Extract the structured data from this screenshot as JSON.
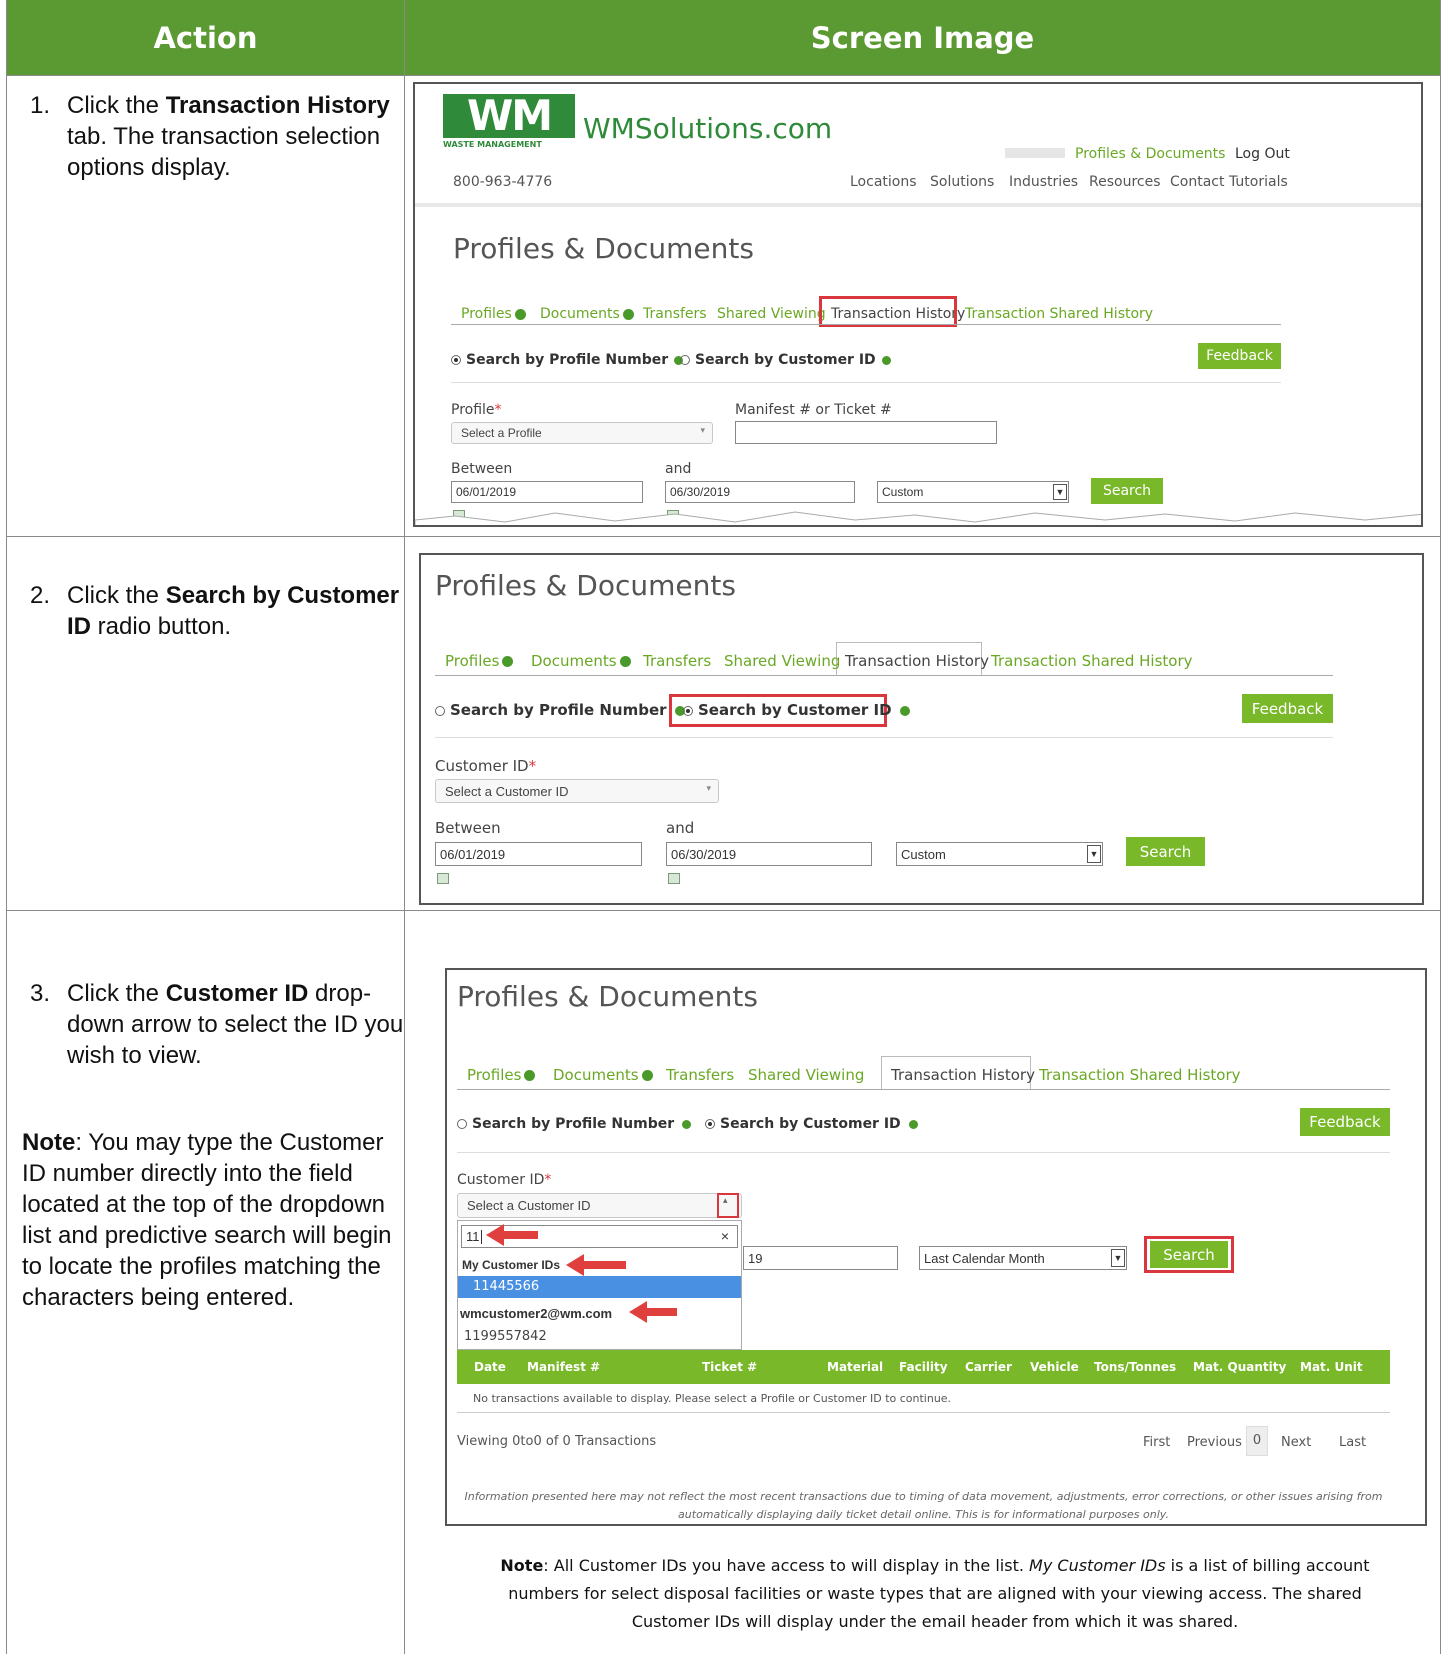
{
  "header": {
    "action": "Action",
    "screen": "Screen Image"
  },
  "steps": [
    {
      "num": "1.",
      "pre": "Click the ",
      "bold": "Transaction History",
      "post": " tab.  The transaction selection options display."
    },
    {
      "num": "2.",
      "pre": "Click the ",
      "bold": "Search by Customer ID",
      "post": " radio button."
    },
    {
      "num": "3.",
      "pre": "Click the ",
      "bold": "Customer ID",
      "post": " drop-down arrow to select the ID you wish to view."
    }
  ],
  "note_left": {
    "bold": "Note",
    "text": ":  You may type the Customer ID number directly into the field located at the top of the dropdown list and predictive search will begin to locate the profiles matching the characters being entered."
  },
  "site": {
    "logo_text": "WM",
    "logo_sub": "WASTE MANAGEMENT",
    "domain": "WMSolutions.com",
    "phone": "800-963-4776",
    "top_links": [
      "Profiles & Documents",
      "Log Out"
    ],
    "nav": [
      "Locations",
      "Solutions",
      "Industries",
      "Resources",
      "Contact",
      "Tutorials"
    ]
  },
  "page_title": "Profiles & Documents",
  "tabs": [
    "Profiles",
    "Documents",
    "Transfers",
    "Shared Viewing",
    "Transaction History",
    "Transaction Shared History"
  ],
  "radios": {
    "profile": "Search by Profile Number",
    "customer": "Search by Customer ID"
  },
  "feedback": "Feedback",
  "form1": {
    "profile_label": "Profile",
    "profile_placeholder": "Select a Profile",
    "manifest_label": "Manifest # or Ticket #",
    "between": "Between",
    "and": "and",
    "date_from": "06/01/2019",
    "date_to": "06/30/2019",
    "range": "Custom",
    "search": "Search"
  },
  "form2": {
    "customer_label": "Customer ID",
    "customer_placeholder": "Select a Customer ID",
    "between": "Between",
    "and": "and",
    "date_from": "06/01/2019",
    "date_to": "06/30/2019",
    "range": "Custom",
    "search": "Search"
  },
  "form3": {
    "customer_label": "Customer ID",
    "customer_placeholder": "Select a Customer ID",
    "typed": "11",
    "group1": "My Customer IDs",
    "item1": "11445566",
    "group2": "wmcustomer2@wm.com",
    "item2": "1199557842",
    "date_to_partial": "19",
    "range": "Last Calendar Month",
    "search": "Search",
    "table_headers": [
      "Date",
      "Manifest #",
      "Ticket #",
      "Material",
      "Facility",
      "Carrier",
      "Vehicle",
      "Tons/Tonnes",
      "Mat. Quantity",
      "Mat. Unit"
    ],
    "empty_msg": "No transactions available to display. Please select a Profile or Customer ID to continue.",
    "viewing": "Viewing",
    "v_from": "0",
    "v_to": "to",
    "v_to_num": "0",
    "v_of": "of",
    "v_total": "0",
    "v_label": "Transactions",
    "pager": [
      "First",
      "Previous",
      "0",
      "Next",
      "Last"
    ],
    "disclaimer1": "Information presented here may not reflect the most recent transactions due to timing of data movement, adjustments, error corrections, or other issues arising from",
    "disclaimer2": "automatically displaying daily ticket detail online. This is for informational purposes only."
  },
  "bottom_note": {
    "bold": "Note",
    "t1": ": All Customer IDs you have access to will display in the list. ",
    "italic": "My Customer IDs",
    "t2": " is a list of billing account numbers for select disposal facilities or waste types that are aligned with your viewing access. The shared Customer IDs will display under the email header from which it was shared."
  },
  "colors": {
    "header_green": "#5b9a33",
    "brand_green": "#6aa824",
    "highlight_red": "#d9363e"
  }
}
